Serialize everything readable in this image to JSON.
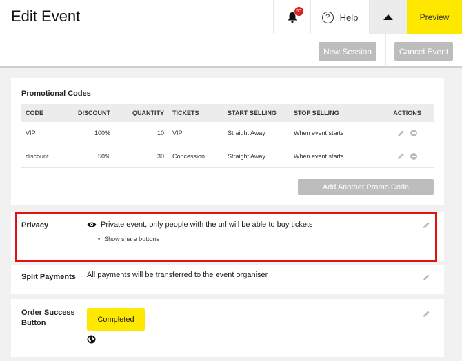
{
  "header": {
    "title": "Edit Event",
    "notifications_count": "50",
    "help_label": "Help",
    "help_glyph": "?",
    "preview_label": "Preview"
  },
  "actions": {
    "new_session_label": "New Session",
    "cancel_event_label": "Cancel Event"
  },
  "promo": {
    "title": "Promotional Codes",
    "columns": [
      "CODE",
      "DISCOUNT",
      "QUANTITY",
      "TICKETS",
      "START SELLING",
      "STOP SELLING",
      "ACTIONS"
    ],
    "rows": [
      {
        "code": "VIP",
        "discount": "100%",
        "quantity": "10",
        "tickets": "VIP",
        "start": "Straight Away",
        "stop": "When event starts"
      },
      {
        "code": "discount",
        "discount": "50%",
        "quantity": "30",
        "tickets": "Concession",
        "start": "Straight Away",
        "stop": "When event starts"
      }
    ],
    "add_label": "Add Another Promo Code"
  },
  "privacy": {
    "label": "Privacy",
    "text": "Private event, only people with the url will be able to buy tickets",
    "bullet": "Show share buttons"
  },
  "split": {
    "label": "Split Payments",
    "text": "All payments will be transferred to the event organiser"
  },
  "order": {
    "label_line1": "Order Success",
    "label_line2": "Button",
    "button_label": "Completed"
  },
  "icons": {
    "bell": "bell-icon",
    "help": "question-circle-icon",
    "caret": "caret-up-icon",
    "edit": "pencil-icon",
    "remove": "minus-circle-icon",
    "eye": "eye-icon",
    "globe": "globe-icon"
  },
  "colors": {
    "accent": "#ffe800",
    "badge": "#d9201b",
    "highlight": "#e01212",
    "disabled_button": "#bdbdbd"
  }
}
